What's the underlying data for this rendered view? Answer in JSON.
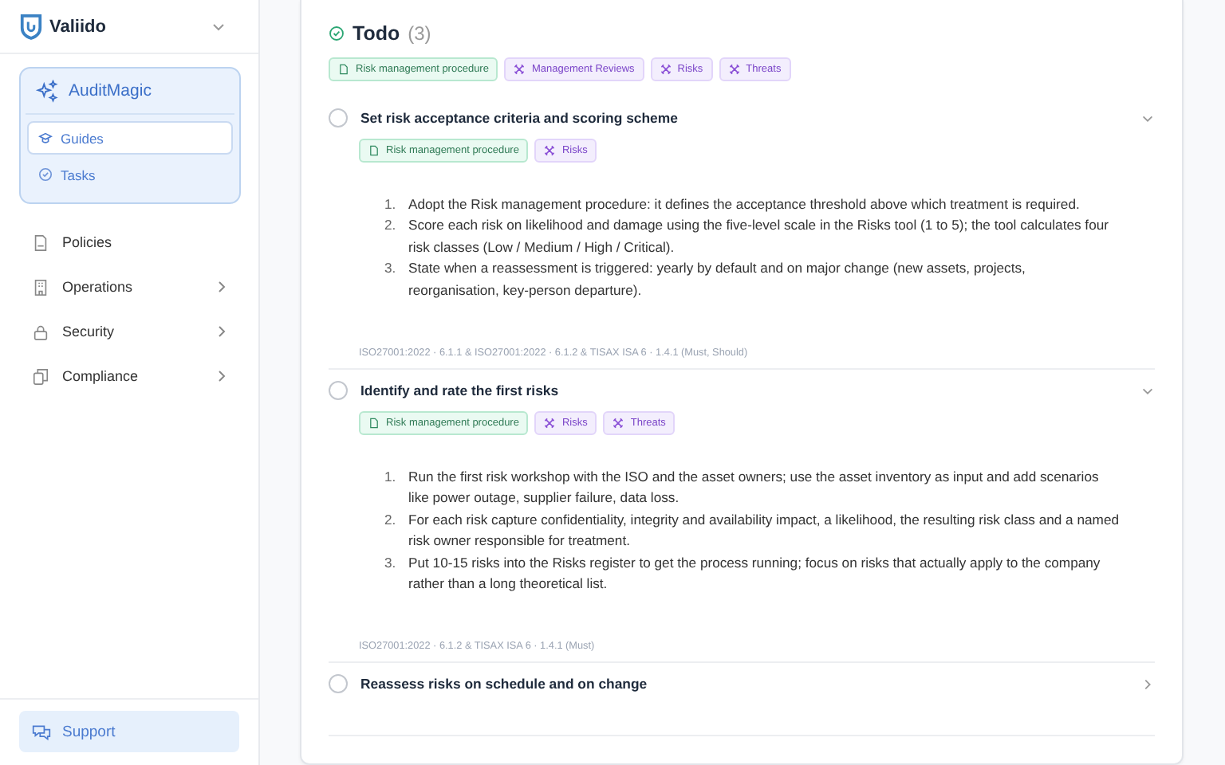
{
  "sidebar": {
    "brand": "Valiido",
    "group": {
      "title": "AuditMagic",
      "items": [
        {
          "label": "Guides",
          "selected": true
        },
        {
          "label": "Tasks",
          "selected": false
        }
      ]
    },
    "items": [
      {
        "label": "Policies",
        "expandable": false
      },
      {
        "label": "Operations",
        "expandable": true
      },
      {
        "label": "Security",
        "expandable": true
      },
      {
        "label": "Compliance",
        "expandable": true
      }
    ],
    "support": "Support"
  },
  "section": {
    "title": "Todo",
    "count": "(3)",
    "tags": [
      {
        "label": "Risk management procedure",
        "kind": "doc"
      },
      {
        "label": "Management Reviews",
        "kind": "tool"
      },
      {
        "label": "Risks",
        "kind": "tool"
      },
      {
        "label": "Threats",
        "kind": "tool"
      }
    ]
  },
  "tasks": [
    {
      "title": "Set risk acceptance criteria and scoring scheme",
      "done": false,
      "expanded": true,
      "tags": [
        {
          "label": "Risk management procedure",
          "kind": "doc"
        },
        {
          "label": "Risks",
          "kind": "tool"
        }
      ],
      "steps": [
        {
          "number": "1.",
          "text": "Adopt the Risk management procedure: it defines the acceptance threshold above which treatment is required."
        },
        {
          "number": "2.",
          "text": "Score each risk on likelihood and damage using the five-level scale in the Risks tool (1 to 5); the tool calculates four risk classes (Low / Medium / High / Critical)."
        },
        {
          "number": "3.",
          "text": "State when a reassessment is triggered: yearly by default and on major change (new assets, projects, reorganisation, key-person departure)."
        }
      ],
      "references": "ISO27001:2022 · 6.1.1 & ISO27001:2022 · 6.1.2 & TISAX ISA 6 · 1.4.1 (Must, Should)"
    },
    {
      "title": "Identify and rate the first risks",
      "done": false,
      "expanded": true,
      "tags": [
        {
          "label": "Risk management procedure",
          "kind": "doc"
        },
        {
          "label": "Risks",
          "kind": "tool"
        },
        {
          "label": "Threats",
          "kind": "tool"
        }
      ],
      "steps": [
        {
          "number": "1.",
          "text": "Run the first risk workshop with the ISO and the asset owners; use the asset inventory as input and add scenarios like power outage, supplier failure, data loss."
        },
        {
          "number": "2.",
          "text": "For each risk capture confidentiality, integrity and availability impact, a likelihood, the resulting risk class and a named risk owner responsible for treatment."
        },
        {
          "number": "3.",
          "text": "Put 10-15 risks into the Risks register to get the process running; focus on risks that actually apply to the company rather than a long theoretical list."
        }
      ],
      "references": "ISO27001:2022 · 6.1.2 & TISAX ISA 6 · 1.4.1 (Must)"
    },
    {
      "title": "Reassess risks on schedule and on change",
      "done": false,
      "expanded": false
    }
  ]
}
